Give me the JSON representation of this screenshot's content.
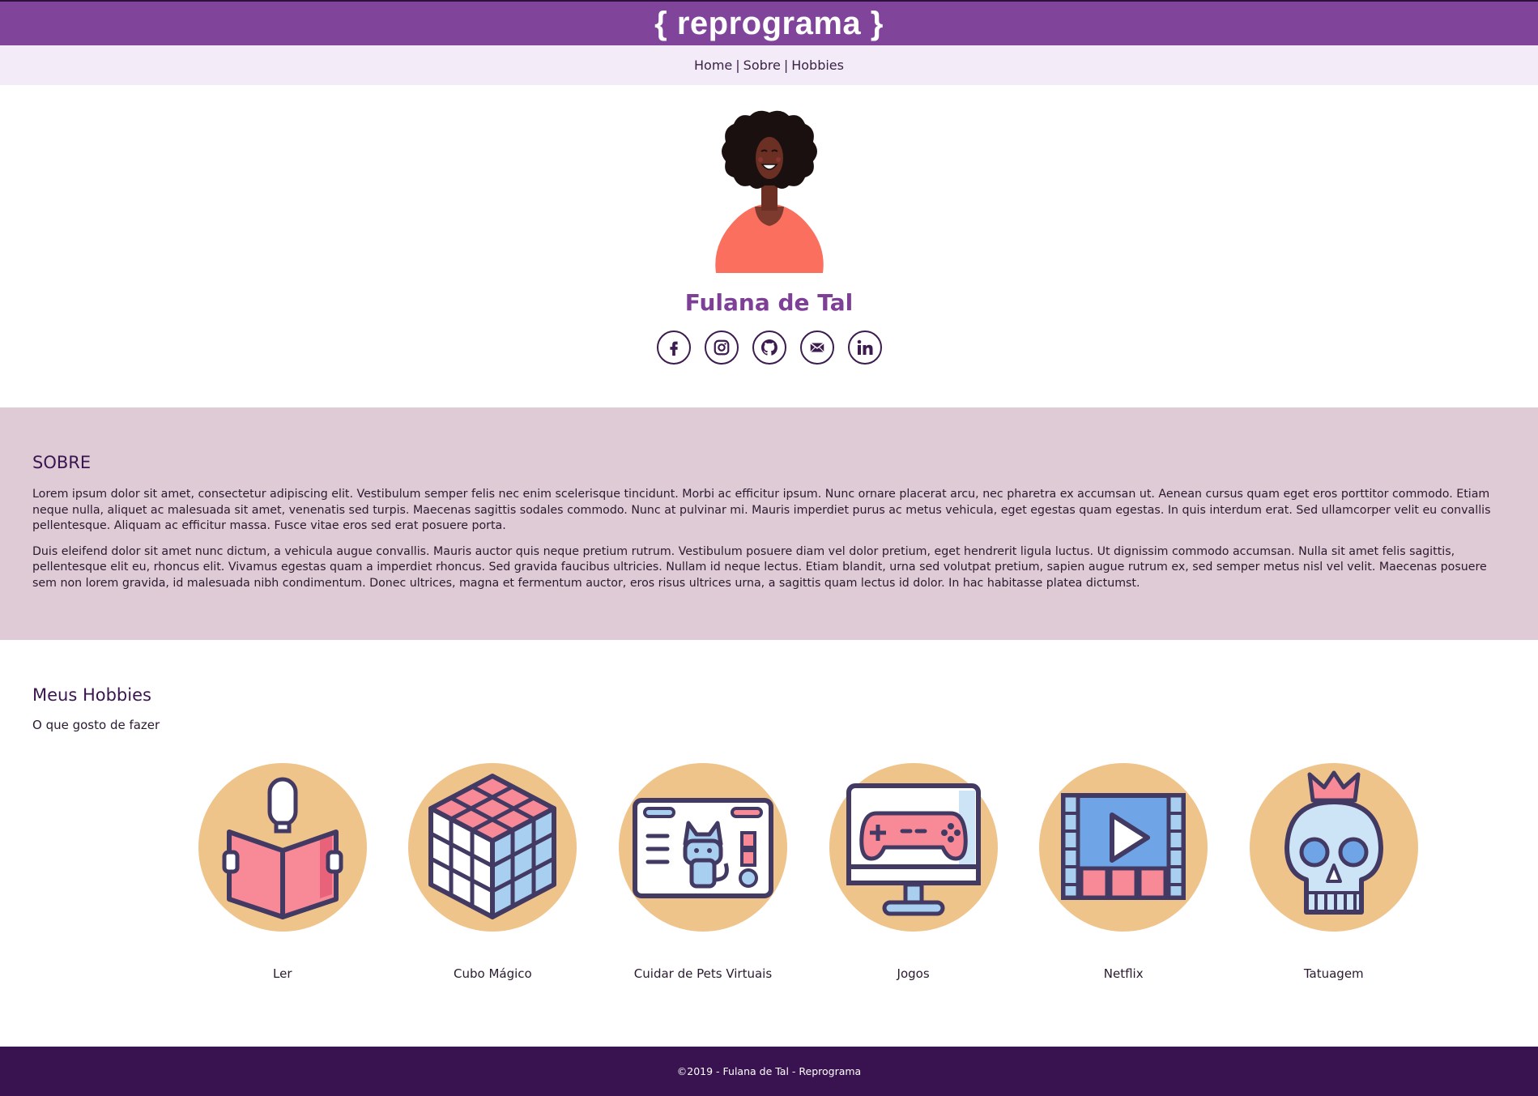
{
  "header": {
    "logo": "{ reprograma }"
  },
  "nav": {
    "items": [
      "Home",
      "Sobre",
      "Hobbies"
    ],
    "separator": "|"
  },
  "profile": {
    "name": "Fulana de Tal",
    "socials": [
      "facebook-icon",
      "instagram-icon",
      "github-icon",
      "mail-icon",
      "linkedin-icon"
    ]
  },
  "about": {
    "title": "SOBRE",
    "paragraphs": [
      "Lorem ipsum dolor sit amet, consectetur adipiscing elit. Vestibulum semper felis nec enim scelerisque tincidunt. Morbi ac efficitur ipsum. Nunc ornare placerat arcu, nec pharetra ex accumsan ut. Aenean cursus quam eget eros porttitor commodo. Etiam neque nulla, aliquet ac malesuada sit amet, venenatis sed turpis. Maecenas sagittis sodales commodo. Nunc at pulvinar mi. Mauris imperdiet purus ac metus vehicula, eget egestas quam egestas. In quis interdum erat. Sed ullamcorper velit eu convallis pellentesque. Aliquam ac efficitur massa. Fusce vitae eros sed erat posuere porta.",
      "Duis eleifend dolor sit amet nunc dictum, a vehicula augue convallis. Mauris auctor quis neque pretium rutrum. Vestibulum posuere diam vel dolor pretium, eget hendrerit ligula luctus. Ut dignissim commodo accumsan. Nulla sit amet felis sagittis, pellentesque elit eu, rhoncus elit. Vivamus egestas quam a imperdiet rhoncus. Sed gravida faucibus ultricies. Nullam id neque lectus. Etiam blandit, urna sed volutpat pretium, sapien augue rutrum ex, sed semper metus nisl vel velit. Maecenas posuere sem non lorem gravida, id malesuada nibh condimentum. Donec ultrices, magna et fermentum auctor, eros risus ultrices urna, a sagittis quam lectus id dolor. In hac habitasse platea dictumst."
    ]
  },
  "hobbies": {
    "title": "Meus Hobbies",
    "subtitle": "O que gosto de fazer",
    "items": [
      {
        "label": "Ler",
        "icon": "reading-book-icon"
      },
      {
        "label": "Cubo Mágico",
        "icon": "rubiks-cube-icon"
      },
      {
        "label": "Cuidar de Pets Virtuais",
        "icon": "virtual-pet-cat-icon"
      },
      {
        "label": "Jogos",
        "icon": "gamepad-monitor-icon"
      },
      {
        "label": "Netflix",
        "icon": "video-player-icon"
      },
      {
        "label": "Tatuagem",
        "icon": "skull-crown-icon"
      }
    ]
  },
  "footer": {
    "text": "©2019 - Fulana de Tal - Reprograma"
  },
  "colors": {
    "header_bg": "#80449a",
    "nav_bg": "#f3ebf8",
    "about_bg": "#dfcbd6",
    "footer_bg": "#39134f",
    "name_color": "#7e3f97",
    "hobby_circle": "#efc48b"
  }
}
